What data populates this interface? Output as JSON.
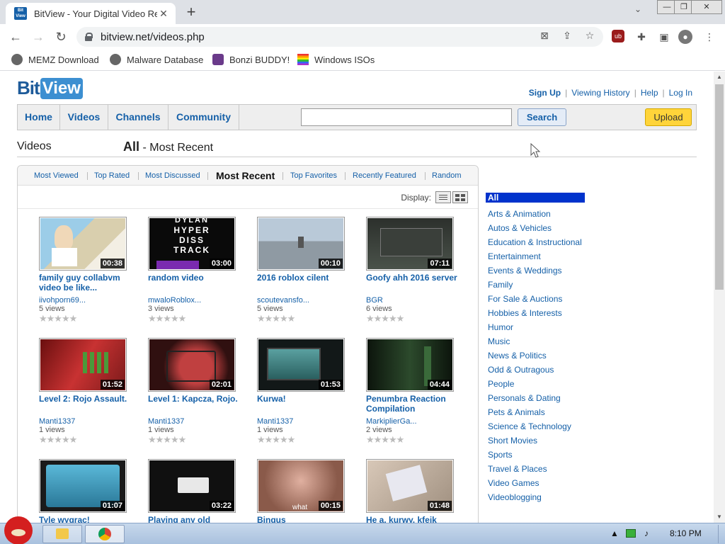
{
  "browser": {
    "tab_title": "BitView - Your Digital Video Re",
    "favicon_text_top": "Bit",
    "favicon_text_bottom": "View",
    "url": "bitview.net/videos.php",
    "bookmarks": [
      "MEMZ Download",
      "Malware Database",
      "Bonzi BUDDY!",
      "Windows ISOs"
    ]
  },
  "site": {
    "logo_bit": "Bit",
    "logo_view": "View",
    "toplinks": {
      "signup": "Sign Up",
      "history": "Viewing History",
      "help": "Help",
      "login": "Log In"
    },
    "nav": [
      "Home",
      "Videos",
      "Channels",
      "Community"
    ],
    "search": {
      "placeholder": "",
      "button": "Search"
    },
    "upload": "Upload",
    "heading_left": "Videos",
    "heading_right_bold": "All",
    "heading_right_rest": " - Most Recent",
    "sort_tabs": [
      "Most Viewed",
      "Top Rated",
      "Most Discussed",
      "Most Recent",
      "Top Favorites",
      "Recently Featured",
      "Random"
    ],
    "display_label": "Display:",
    "stars": "★★★★★"
  },
  "videos": [
    {
      "title": "family guy collabvm video be like...",
      "duration": "00:38",
      "user": "iivohporn69...",
      "views": "5 views",
      "color": "#7ab0d0"
    },
    {
      "title": "random video",
      "duration": "03:00",
      "user": "mwaloRoblox...",
      "views": "3 views",
      "color": "#101010"
    },
    {
      "title": "2016 roblox cilent",
      "duration": "00:10",
      "user": "scoutevansfo...",
      "views": "5 views",
      "color": "#a9b7c7"
    },
    {
      "title": "Goofy ahh 2016 server",
      "duration": "07:11",
      "user": "BGR",
      "views": "6 views",
      "color": "#3a4038"
    },
    {
      "title": "Level 2: Rojo Assault.",
      "duration": "01:52",
      "user": "Manti1337",
      "views": "1 views",
      "color": "#b02a2a"
    },
    {
      "title": "Level 1: Kapcza, Rojo.",
      "duration": "02:01",
      "user": "Manti1337",
      "views": "1 views",
      "color": "#502020"
    },
    {
      "title": "Kurwa!",
      "duration": "01:53",
      "user": "Manti1337",
      "views": "1 views",
      "color": "#1e2a2a"
    },
    {
      "title": "Penumbra Reaction Compilation",
      "duration": "04:44",
      "user": "MarkiplierGa...",
      "views": "2 views",
      "color": "#1a2a1a"
    },
    {
      "title": "Tyle wygrac!",
      "duration": "01:07",
      "user": "",
      "views": "",
      "color": "#3a8aa8"
    },
    {
      "title": "Playing any old",
      "duration": "03:22",
      "user": "",
      "views": "",
      "color": "#121212"
    },
    {
      "title": "Bingus",
      "duration": "00:15",
      "user": "",
      "views": "",
      "color": "#b07a68"
    },
    {
      "title": "He a, kurwy, kfeik",
      "duration": "01:48",
      "user": "",
      "views": "",
      "color": "#b0a090"
    }
  ],
  "categories": [
    "All",
    "Arts & Animation",
    "Autos & Vehicles",
    "Education & Instructional",
    "Entertainment",
    "Events & Weddings",
    "Family",
    "For Sale & Auctions",
    "Hobbies & Interests",
    "Humor",
    "Music",
    "News & Politics",
    "Odd & Outragous",
    "People",
    "Personals & Dating",
    "Pets & Animals",
    "Science & Technology",
    "Short Movies",
    "Sports",
    "Travel & Places",
    "Video Games",
    "Videoblogging"
  ],
  "taskbar": {
    "clock": "8:10 PM"
  },
  "thumb_captions": {
    "v1_top": "DYLAN",
    "v1_lines": [
      "HYPER",
      "DISS",
      "TRACK"
    ],
    "v10_word": "what"
  }
}
